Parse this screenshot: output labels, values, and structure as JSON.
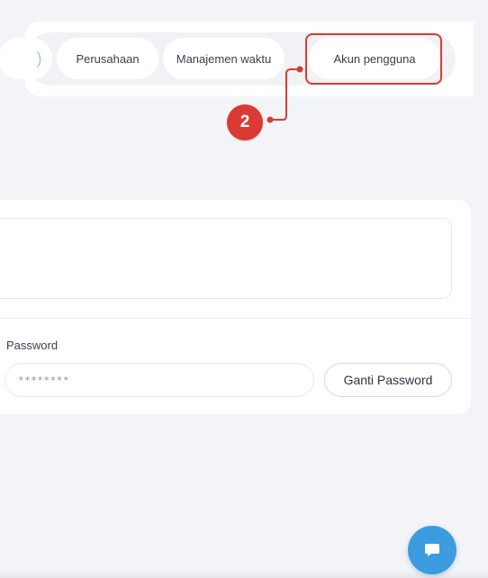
{
  "tabs": {
    "items": [
      {
        "id": "perusahaan",
        "label": "Perusahaan"
      },
      {
        "id": "manajemen-waktu",
        "label": "Manajemen waktu"
      },
      {
        "id": "akun-pengguna",
        "label": "Akun pengguna"
      }
    ],
    "highlighted": "akun-pengguna"
  },
  "annotation": {
    "step_number": "2",
    "color": "#db3a34"
  },
  "account": {
    "password_label": "Password",
    "password_value": "********",
    "change_password_label": "Ganti Password"
  },
  "chat": {
    "icon": "chat-bubble-icon",
    "color": "#3d9be0"
  },
  "colors": {
    "accent": "#3d9be0",
    "highlight": "#dc3a35",
    "background": "#f3f4f7"
  }
}
